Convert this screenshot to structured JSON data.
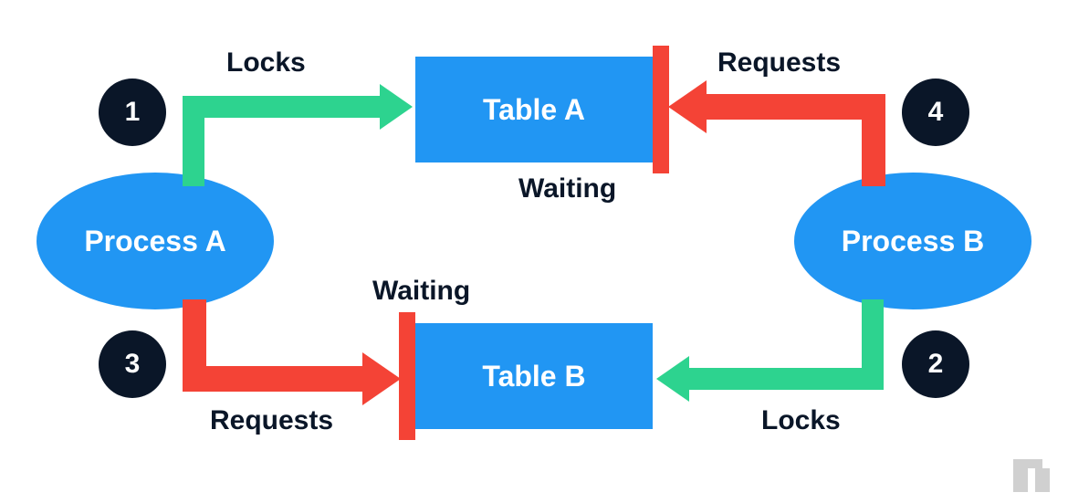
{
  "nodes": {
    "process_a": "Process A",
    "process_b": "Process B",
    "table_a": "Table A",
    "table_b": "Table B"
  },
  "steps": {
    "s1": "1",
    "s2": "2",
    "s3": "3",
    "s4": "4"
  },
  "labels": {
    "locks_top": "Locks",
    "requests_top": "Requests",
    "waiting_top": "Waiting",
    "waiting_bottom": "Waiting",
    "requests_bottom": "Requests",
    "locks_bottom": "Locks"
  },
  "colors": {
    "process": "#2196f3",
    "table": "#2196f3",
    "step": "#0a1628",
    "lock_arrow": "#2dd38f",
    "request_arrow": "#f44336",
    "wait_bar": "#f44336",
    "text": "#0a1628"
  },
  "chart_data": {
    "type": "diagram",
    "description": "Deadlock illustration between two processes and two tables",
    "nodes": [
      {
        "id": "process_a",
        "kind": "process",
        "label": "Process A"
      },
      {
        "id": "process_b",
        "kind": "process",
        "label": "Process B"
      },
      {
        "id": "table_a",
        "kind": "table",
        "label": "Table A"
      },
      {
        "id": "table_b",
        "kind": "table",
        "label": "Table B"
      }
    ],
    "edges": [
      {
        "step": 1,
        "from": "process_a",
        "to": "table_a",
        "action": "Locks",
        "color": "green"
      },
      {
        "step": 2,
        "from": "process_b",
        "to": "table_b",
        "action": "Locks",
        "color": "green"
      },
      {
        "step": 3,
        "from": "process_a",
        "to": "table_b",
        "action": "Requests",
        "state": "Waiting",
        "color": "red"
      },
      {
        "step": 4,
        "from": "process_b",
        "to": "table_a",
        "action": "Requests",
        "state": "Waiting",
        "color": "red"
      }
    ]
  }
}
